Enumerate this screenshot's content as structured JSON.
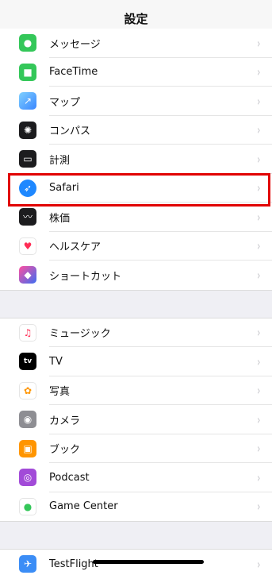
{
  "navbar": {
    "title": "設定"
  },
  "groups": [
    {
      "items": [
        {
          "label": "メッセージ",
          "icon": "messages-icon",
          "color": "#34c759",
          "glyph": "💬"
        },
        {
          "label": "FaceTime",
          "icon": "facetime-icon",
          "color": "#34c759",
          "glyph": "■"
        },
        {
          "label": "マップ",
          "icon": "maps-icon",
          "color": "#6fb7ff",
          "glyph": "↗"
        },
        {
          "label": "コンパス",
          "icon": "compass-icon",
          "color": "#1c1c1e",
          "glyph": "✺"
        },
        {
          "label": "計測",
          "icon": "measure-icon",
          "color": "#1c1c1e",
          "glyph": "▭"
        },
        {
          "label": "Safari",
          "icon": "safari-icon",
          "color": "#1e88ff",
          "glyph": "➶"
        },
        {
          "label": "株価",
          "icon": "stocks-icon",
          "color": "#1c1c1e",
          "glyph": "〰"
        },
        {
          "label": "ヘルスケア",
          "icon": "health-icon",
          "color": "#ffffff",
          "glyph": "♥"
        },
        {
          "label": "ショートカット",
          "icon": "shortcuts-icon",
          "color": "#6a3df0",
          "glyph": "◆"
        }
      ]
    },
    {
      "items": [
        {
          "label": "ミュージック",
          "icon": "music-icon",
          "color": "#ffffff",
          "glyph": "♫"
        },
        {
          "label": "TV",
          "icon": "tv-icon",
          "color": "#000000",
          "glyph": "tv"
        },
        {
          "label": "写真",
          "icon": "photos-icon",
          "color": "#ffffff",
          "glyph": "✿"
        },
        {
          "label": "カメラ",
          "icon": "camera-icon",
          "color": "#8e8e93",
          "glyph": "◉"
        },
        {
          "label": "ブック",
          "icon": "books-icon",
          "color": "#ff9500",
          "glyph": "▣"
        },
        {
          "label": "Podcast",
          "icon": "podcast-icon",
          "color": "#a24bd8",
          "glyph": "◎"
        },
        {
          "label": "Game Center",
          "icon": "game-center-icon",
          "color": "#ffffff",
          "glyph": "●"
        }
      ]
    },
    {
      "items": [
        {
          "label": "TestFlight",
          "icon": "testflight-icon",
          "color": "#3b8df6",
          "glyph": "✈"
        }
      ]
    }
  ],
  "chevron": "›",
  "highlight_color": "#e10000"
}
